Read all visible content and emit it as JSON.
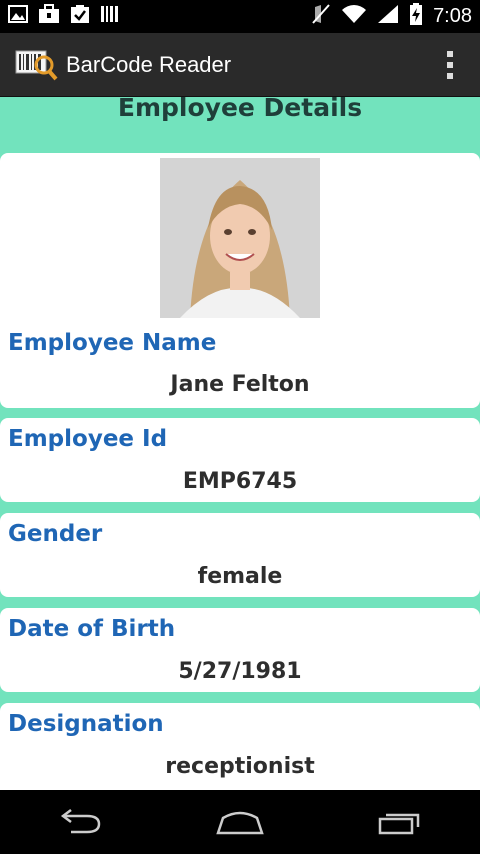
{
  "status_bar": {
    "time": "7:08",
    "icons": [
      "gallery-icon",
      "briefcase-icon",
      "clipboard-check-icon",
      "barcode-icon",
      "mute-icon",
      "wifi-icon",
      "signal-icon",
      "battery-charging-icon"
    ]
  },
  "action_bar": {
    "title": "BarCode Reader",
    "app_icon": "barcode-reader-icon",
    "overflow_icon": "overflow-menu-icon"
  },
  "page": {
    "heading": "Employee Details"
  },
  "fields": [
    {
      "label": "Employee Name",
      "value": "Jane Felton"
    },
    {
      "label": "Employee Id",
      "value": "EMP6745"
    },
    {
      "label": "Gender",
      "value": "female"
    },
    {
      "label": "Date of Birth",
      "value": "5/27/1981"
    },
    {
      "label": "Designation",
      "value": "receptionist"
    }
  ],
  "colors": {
    "content_bg": "#72e3bd",
    "label": "#1f66b5",
    "action_bar": "#2a2a2a"
  },
  "nav_bar": {
    "icons": [
      "back-icon",
      "home-icon",
      "recent-apps-icon"
    ]
  }
}
